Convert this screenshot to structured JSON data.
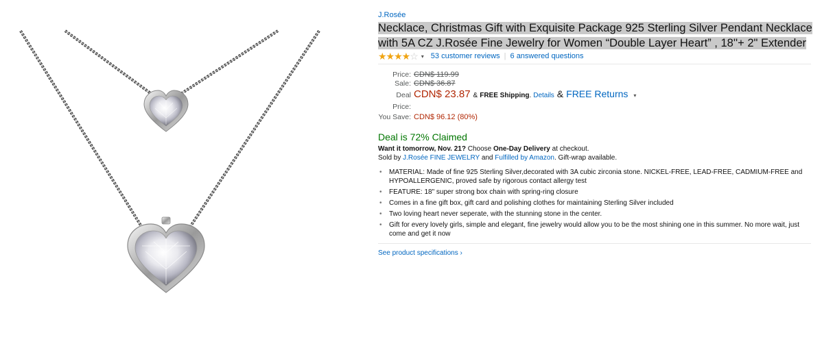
{
  "product": {
    "brand": "J.Rosée",
    "title": "Necklace, Christmas Gift with Exquisite Package 925 Sterling Silver Pendant Necklace with 5A CZ J.Rosée Fine Jewelry for Women “Double Layer Heart” , 18''+ 2\" Extender",
    "rating": 4.0,
    "stars": "★★★★",
    "star_empty": "☆",
    "caret": "▾",
    "reviews_label": "53 customer reviews",
    "separator": "|",
    "questions_label": "6 answered questions"
  },
  "pricing": {
    "price_label": "Price:",
    "price_value": "CDN$ 119.99",
    "sale_label": "Sale:",
    "sale_value": "CDN$ 36.87",
    "deal_label": "Deal Price:",
    "deal_value": "CDN$ 23.87",
    "shipping_prefix": "&",
    "shipping_bold": "FREE Shipping",
    "shipping_suffix": ".",
    "details_link": "Details",
    "returns_prefix": "&",
    "returns_link": "FREE Returns",
    "returns_caret": "▾",
    "save_label": "You Save:",
    "save_value": "CDN$ 96.12 (80%)"
  },
  "deal": {
    "claimed_text": "Deal is 72% Claimed"
  },
  "delivery": {
    "want_bold": "Want it tomorrow, Nov. 21?",
    "choose": "Choose",
    "one_day_bold": "One-Day Delivery",
    "checkout": "at checkout.",
    "sold_by": "Sold by",
    "seller_link": "J.Rosée FINE JEWELRY",
    "and": "and",
    "fulfilled_link": "Fulfilled by Amazon",
    "gift_wrap": ". Gift-wrap available."
  },
  "bullets": [
    "MATERIAL: Made of fine 925 Sterling Silver,decorated with 3A cubic zirconia stone. NICKEL-FREE, LEAD-FREE, CADMIUM-FREE and HYPOALLERGENIC, proved safe by rigorous contact allergy test",
    "FEATURE: 18\" super strong box chain with spring-ring closure",
    "Comes in a fine gift box, gift card and polishing clothes for maintaining Sterling Silver included",
    "Two loving heart never seperate, with the stunning stone in the center.",
    "Gift for every lovely girls, simple and elegant, fine jewelry would allow you to be the most shining one in this summer. No more wait, just come and get it now"
  ],
  "specs_link": "See product specifications ›",
  "colors": {
    "link": "#0066c0",
    "price_red": "#b12704",
    "deal_green": "#007600",
    "star": "#f0a412",
    "title_highlight": "#c9c9c9"
  }
}
